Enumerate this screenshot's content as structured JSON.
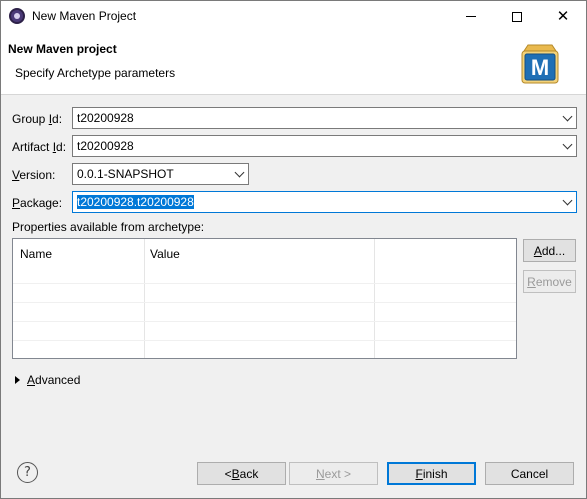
{
  "window": {
    "title": "New Maven Project",
    "close_glyph": "✕"
  },
  "banner": {
    "title": "New Maven project",
    "subtitle": "Specify Archetype parameters",
    "logo_letter": "M"
  },
  "form": {
    "group_id": {
      "label_pre": "Group ",
      "label_u": "I",
      "label_post": "d:",
      "value": "t20200928"
    },
    "artifact_id": {
      "label_pre": "Artifact ",
      "label_u": "I",
      "label_post": "d:",
      "value": "t20200928"
    },
    "version": {
      "label_pre": "",
      "label_u": "V",
      "label_post": "ersion:",
      "value": "0.0.1-SNAPSHOT"
    },
    "package": {
      "label_pre": "",
      "label_u": "P",
      "label_post": "ackage:",
      "value": "t20200928.t20200928"
    }
  },
  "properties": {
    "label": "Properties available from archetype:",
    "columns": [
      "Name",
      "Value"
    ],
    "add_pre": "",
    "add_u": "A",
    "add_post": "dd...",
    "remove_pre": "",
    "remove_u": "R",
    "remove_post": "emove"
  },
  "advanced": {
    "pre": "",
    "u": "A",
    "post": "dvanced"
  },
  "footer": {
    "help_glyph": "?",
    "back": {
      "pre": "< ",
      "u": "B",
      "post": "ack"
    },
    "next": {
      "pre": "",
      "u": "N",
      "post": "ext >"
    },
    "finish": {
      "pre": "",
      "u": "F",
      "post": "inish"
    },
    "cancel": "Cancel"
  },
  "colors": {
    "accent": "#0078d7",
    "maven_blue": "#1f6fb5",
    "maven_box": "#f3d27a"
  }
}
